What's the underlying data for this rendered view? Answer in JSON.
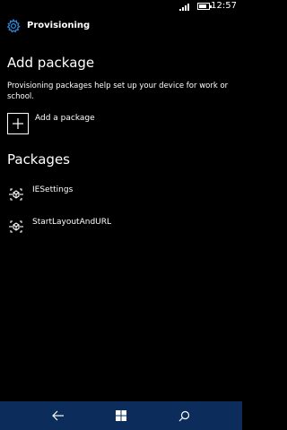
{
  "status_bar": {
    "time": "12:57",
    "battery_level": 0.75
  },
  "header": {
    "title": "Provisioning",
    "icon": "gear-icon"
  },
  "add_section": {
    "heading": "Add package",
    "description": "Provisioning packages help set up your device for work or school.",
    "add_label": "Add a package",
    "add_icon": "plus-icon"
  },
  "packages_section": {
    "heading": "Packages",
    "items": [
      {
        "label": "IESettings",
        "icon": "package-icon"
      },
      {
        "label": "StartLayoutAndURL",
        "icon": "package-icon"
      }
    ]
  },
  "nav_bar": {
    "color": "#0c2c5c",
    "buttons": [
      "back-icon",
      "windows-start-icon",
      "search-icon"
    ]
  },
  "colors": {
    "accent": "#2b88d8",
    "background": "#000000",
    "text": "#ffffff"
  }
}
